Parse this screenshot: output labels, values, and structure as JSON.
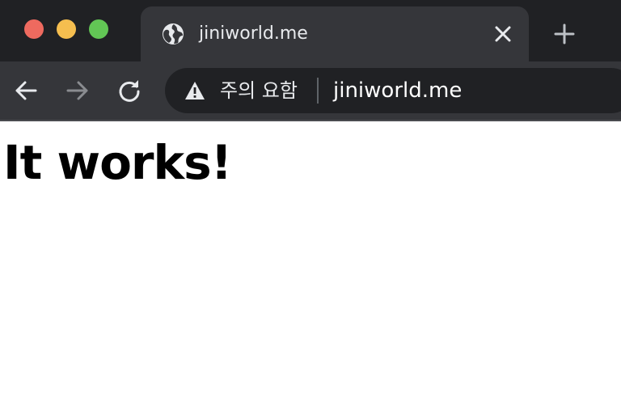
{
  "browser": {
    "tab": {
      "title": "jiniworld.me",
      "favicon": "globe-icon",
      "close_icon": "close-icon"
    },
    "new_tab_icon": "plus-icon",
    "toolbar": {
      "back_icon": "arrow-left-icon",
      "forward_icon": "arrow-right-icon",
      "reload_icon": "reload-icon"
    },
    "omnibox": {
      "security_icon": "warning-icon",
      "security_label": "주의 요함",
      "url": "jiniworld.me"
    },
    "colors": {
      "tabbar": "#202124",
      "tab_active": "#35363a",
      "omnibox": "#202124",
      "traffic_red": "#ee6a5f",
      "traffic_yellow": "#f5be4f",
      "traffic_green": "#62c655"
    }
  },
  "page": {
    "heading": "It works!"
  }
}
